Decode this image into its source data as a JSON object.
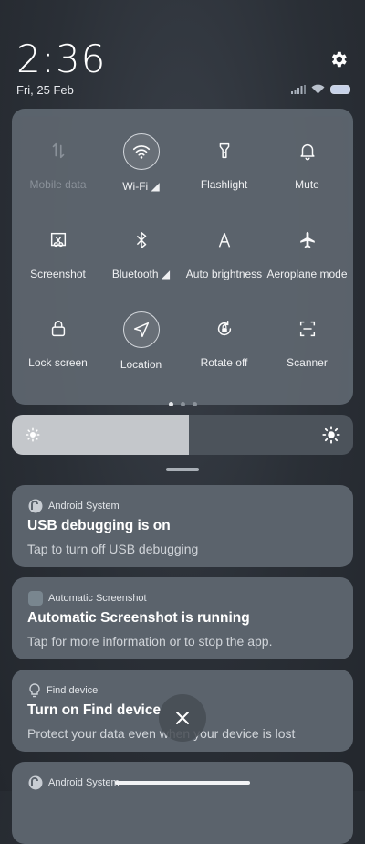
{
  "status": {
    "time": "2:36",
    "date": "Fri, 25 Feb"
  },
  "tiles": [
    {
      "id": "mobile-data",
      "label": "Mobile data",
      "icon": "mobile-data-icon",
      "active": false,
      "disabled": true
    },
    {
      "id": "wifi",
      "label": "Wi-Fi ◢",
      "icon": "wifi-icon",
      "active": true,
      "disabled": false
    },
    {
      "id": "flashlight",
      "label": "Flashlight",
      "icon": "flashlight-icon",
      "active": false,
      "disabled": false
    },
    {
      "id": "mute",
      "label": "Mute",
      "icon": "bell-icon",
      "active": false,
      "disabled": false
    },
    {
      "id": "screenshot",
      "label": "Screenshot",
      "icon": "screenshot-icon",
      "active": false,
      "disabled": false
    },
    {
      "id": "bluetooth",
      "label": "Bluetooth ◢",
      "icon": "bluetooth-icon",
      "active": false,
      "disabled": false
    },
    {
      "id": "auto-brightness",
      "label": "Auto brightness",
      "icon": "auto-brightness-icon",
      "active": false,
      "disabled": false
    },
    {
      "id": "aeroplane",
      "label": "Aeroplane mode",
      "icon": "airplane-icon",
      "active": false,
      "disabled": false
    },
    {
      "id": "lock-screen",
      "label": "Lock screen",
      "icon": "lock-icon",
      "active": false,
      "disabled": false
    },
    {
      "id": "location",
      "label": "Location",
      "icon": "location-icon",
      "active": true,
      "disabled": false
    },
    {
      "id": "rotate",
      "label": "Rotate off",
      "icon": "rotate-lock-icon",
      "active": false,
      "disabled": false
    },
    {
      "id": "scanner",
      "label": "Scanner",
      "icon": "scanner-icon",
      "active": false,
      "disabled": false
    }
  ],
  "pager": {
    "pages": 3,
    "current": 0
  },
  "brightness": {
    "level": 0.52
  },
  "notifications": [
    {
      "app": "Android System",
      "title": "USB debugging is on",
      "text": "Tap to turn off USB debugging",
      "icon": "android-system-icon"
    },
    {
      "app": "Automatic Screenshot",
      "title": "Automatic Screenshot is running",
      "text": "Tap for more information or to stop the app.",
      "icon": "auto-screenshot-app-icon"
    },
    {
      "app": "Find device",
      "title": "Turn on Find device",
      "text": "Protect your data even when your device is lost",
      "icon": "find-device-icon"
    },
    {
      "app": "Android System",
      "title": "",
      "text": "",
      "icon": "android-system-icon"
    }
  ],
  "colors": {
    "panel": "#5c646d",
    "card": "#5b636c",
    "slider_fill": "#c4c7cb",
    "slider_track": "#4c535b"
  }
}
